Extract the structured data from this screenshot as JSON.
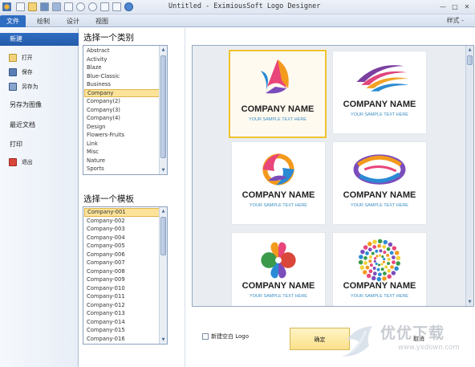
{
  "titlebar": {
    "app_title": "Untitled - EximiousSoft Logo Designer",
    "minimize": "—",
    "maximize": "□",
    "close": "✕"
  },
  "ribbon": {
    "tabs": [
      "文件",
      "绘制",
      "设计",
      "视图"
    ],
    "style_label": "样式 -"
  },
  "left_menu": {
    "items": [
      {
        "label": "新建",
        "icon": null
      },
      {
        "label": "打开",
        "icon": "open-folder-icon"
      },
      {
        "label": "保存",
        "icon": "save-icon"
      },
      {
        "label": "另存为",
        "icon": "save-as-icon"
      },
      {
        "label": "另存为图像",
        "icon": null
      },
      {
        "label": "最近文档",
        "icon": null
      },
      {
        "label": "打印",
        "icon": null
      },
      {
        "label": "退出",
        "icon": "exit-icon"
      }
    ]
  },
  "category": {
    "title": "选择一个类别",
    "items": [
      "Abstract",
      "Activity",
      "Blaze",
      "Blue-Classic",
      "Business",
      "Company",
      "Company(2)",
      "Company(3)",
      "Company(4)",
      "Design",
      "Flowers-Fruits",
      "Link",
      "Misc",
      "Nature",
      "Sports"
    ],
    "selected": "Company"
  },
  "template": {
    "title": "选择一个模板",
    "items": [
      "Company-001",
      "Company-002",
      "Company-003",
      "Company-004",
      "Company-005",
      "Company-006",
      "Company-007",
      "Company-008",
      "Company-009",
      "Company-010",
      "Company-011",
      "Company-012",
      "Company-013",
      "Company-014",
      "Company-015",
      "Company-016"
    ],
    "selected": "Company-001"
  },
  "preview": {
    "cards": [
      {
        "name": "COMPANY NAME",
        "tagline": "YOUR SAMPLE TEXT HERE",
        "selected": true,
        "icon": "triangle-swirl-logo-icon"
      },
      {
        "name": "COMPANY NAME",
        "tagline": "YOUR SAMPLE TEXT HERE",
        "selected": false,
        "icon": "wing-stripes-logo-icon"
      },
      {
        "name": "COMPANY NAME",
        "tagline": "YOUR SAMPLE TEXT HERE",
        "selected": false,
        "icon": "ring-swirl-logo-icon"
      },
      {
        "name": "COMPANY NAME",
        "tagline": "YOUR SAMPLE TEXT HERE",
        "selected": false,
        "icon": "ellipse-swoosh-logo-icon"
      },
      {
        "name": "COMPANY NAME",
        "tagline": "YOUR SAMPLE TEXT HERE",
        "selected": false,
        "icon": "heart-clover-logo-icon"
      },
      {
        "name": "COMPANY NAME",
        "tagline": "YOUR SAMPLE TEXT HERE",
        "selected": false,
        "icon": "dot-spiral-logo-icon"
      }
    ]
  },
  "footer": {
    "blank_logo_label": "新建空白 Logo",
    "ok_label": "确定",
    "cancel_label": "取消"
  },
  "watermark": {
    "text": "优优下载",
    "url": "www.yxdown.com"
  },
  "colors": {
    "accent": "#2f6dc2",
    "selection": "#fde39a",
    "brand_blue": "#3d8fc4"
  }
}
